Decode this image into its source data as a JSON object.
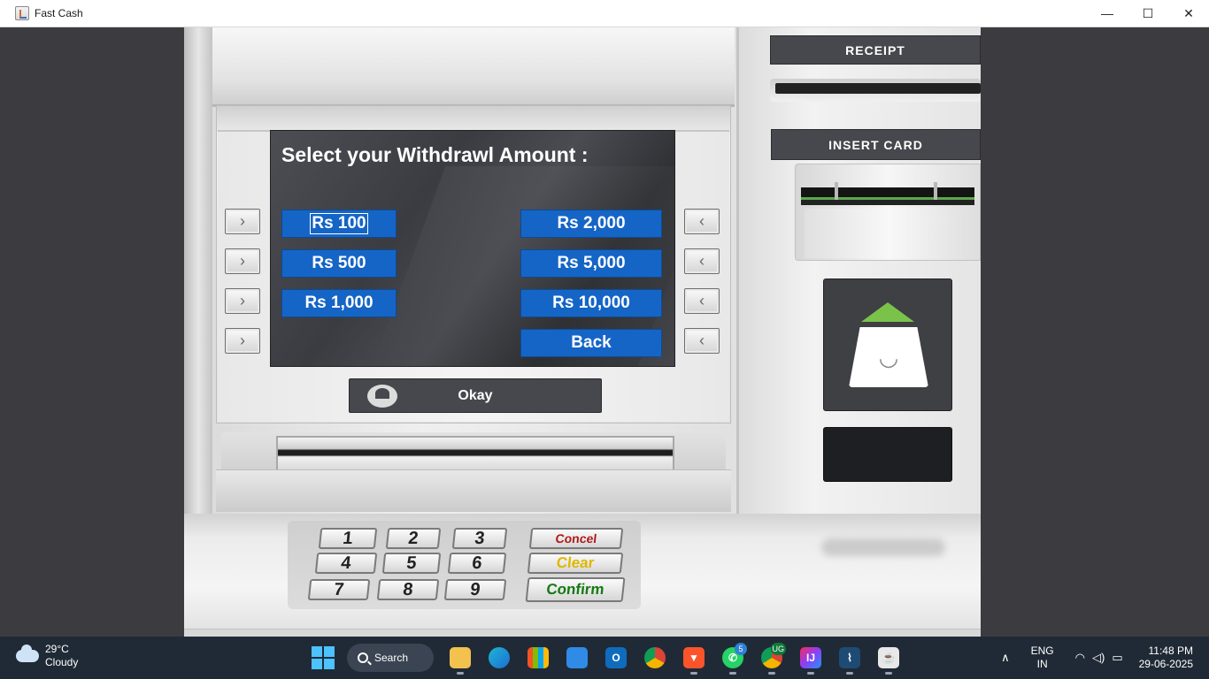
{
  "window": {
    "title": "Fast Cash",
    "minimize_glyph": "—",
    "maximize_glyph": "☐",
    "close_glyph": "✕"
  },
  "screen": {
    "title": "Select your Withdrawl Amount :",
    "buttons": {
      "rs100": "Rs 100",
      "rs500": "Rs 500",
      "rs1000": "Rs 1,000",
      "rs2000": "Rs 2,000",
      "rs5000": "Rs 5,000",
      "rs10000": "Rs 10,000",
      "back": "Back"
    }
  },
  "atm": {
    "okay_label": "Okay",
    "receipt_label": "RECEIPT",
    "insert_card_label": "INSERT CARD",
    "side_left_glyph": "›",
    "side_right_glyph": "‹",
    "keypad": {
      "k1": "1",
      "k2": "2",
      "k3": "3",
      "k4": "4",
      "k5": "5",
      "k6": "6",
      "k7": "7",
      "k8": "8",
      "k9": "9",
      "cancel": "Concel",
      "clear": "Clear",
      "confirm": "Confirm"
    }
  },
  "taskbar": {
    "weather_temp": "29°C",
    "weather_desc": "Cloudy",
    "search_label": "Search",
    "whatsapp_badge": "5",
    "chrome_badge": "UG",
    "lang_line1": "ENG",
    "lang_line2": "IN",
    "time": "11:48 PM",
    "date": "29-06-2025",
    "icons": [
      "file-explorer-icon",
      "edge-icon",
      "store-icon",
      "mail-icon",
      "outlook-icon",
      "chrome-icon",
      "brave-icon",
      "whatsapp-icon",
      "chrome-profile-icon",
      "intellij-icon",
      "mysql-workbench-icon",
      "java-icon"
    ]
  }
}
